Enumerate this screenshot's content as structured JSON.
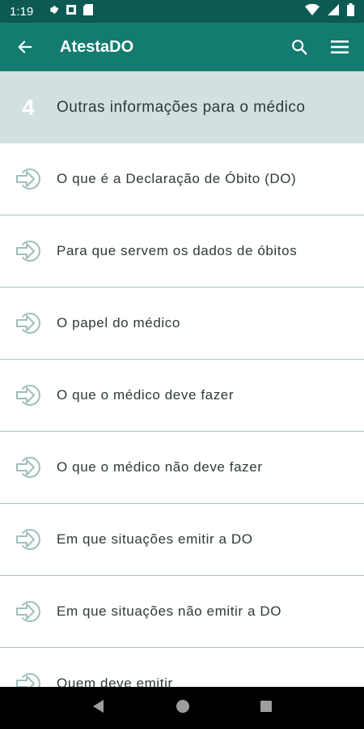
{
  "status_bar": {
    "time": "1:19",
    "left_icons": [
      "settings-icon",
      "notification-icon",
      "sd-card-icon"
    ],
    "right_icons": [
      "wifi-icon",
      "signal-icon",
      "battery-icon"
    ]
  },
  "app_bar": {
    "title": "AtestaDO",
    "back_icon": "arrow-back-icon",
    "actions": [
      "search-icon",
      "menu-icon"
    ]
  },
  "section": {
    "number": "4",
    "title": "Outras informações para o médico"
  },
  "list": {
    "items": [
      {
        "label": "O que é a Declaração de Óbito (DO)"
      },
      {
        "label": "Para que servem os dados de óbitos"
      },
      {
        "label": "O papel do médico"
      },
      {
        "label": "O que o médico deve fazer"
      },
      {
        "label": "O que o médico não deve fazer"
      },
      {
        "label": "Em que situações emitir a DO"
      },
      {
        "label": "Em que situações não emitir a DO"
      },
      {
        "label": "Quem deve emitir"
      }
    ]
  },
  "colors": {
    "status_bar": "#0c5a52",
    "app_bar": "#137b6f",
    "section_header": "#d2e1df",
    "divider": "#a9c5c1",
    "icon_tint": "#9fbfbb"
  },
  "nav_bar": {
    "buttons": [
      "back-triangle-icon",
      "home-circle-icon",
      "recents-square-icon"
    ]
  }
}
